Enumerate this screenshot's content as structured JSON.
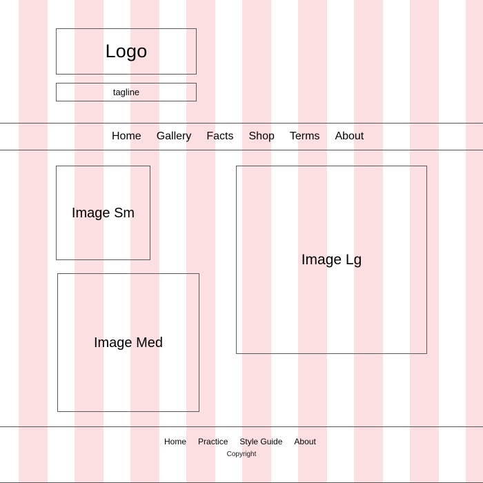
{
  "theme": {
    "stripe_color": "#fcdfe0",
    "background_color": "#ffffff",
    "border_color": "#5a5a5a",
    "rule_color": "#555555",
    "text_color": "#000000"
  },
  "header": {
    "logo_label": "Logo",
    "tagline_label": "tagline"
  },
  "main_nav": {
    "items": [
      {
        "label": "Home"
      },
      {
        "label": "Gallery"
      },
      {
        "label": "Facts"
      },
      {
        "label": "Shop"
      },
      {
        "label": "Terms"
      },
      {
        "label": "About"
      }
    ]
  },
  "content": {
    "images": [
      {
        "label": "Image Sm"
      },
      {
        "label": "Image Med"
      },
      {
        "label": "Image Lg"
      }
    ]
  },
  "footer": {
    "items": [
      {
        "label": "Home"
      },
      {
        "label": "Practice"
      },
      {
        "label": "Style Guide"
      },
      {
        "label": "About"
      }
    ],
    "copyright": "Copyright"
  }
}
